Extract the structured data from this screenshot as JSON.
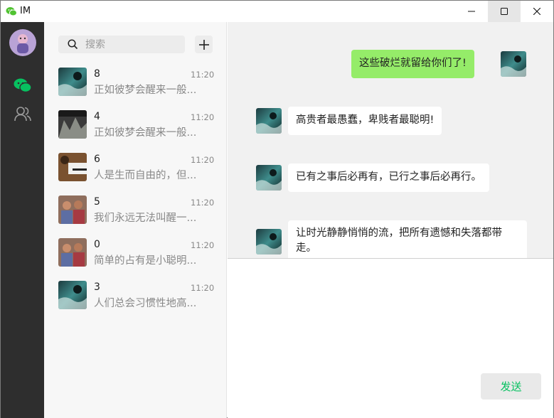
{
  "window": {
    "title": "IM"
  },
  "icons": {
    "app": "wechat-icon",
    "minimize": "minimize-icon",
    "maximize": "maximize-icon",
    "close": "close-icon",
    "chat_nav": "chat-bubbles-icon",
    "contacts_nav": "contacts-icon",
    "search": "search-icon",
    "add": "plus-icon"
  },
  "colors": {
    "nav_bg": "#2e2e2e",
    "accent_green": "#07c160",
    "my_bubble": "#95ec69",
    "their_bubble": "#ffffff",
    "list_bg": "#f7f7f7",
    "chat_bg": "#f1f1f1"
  },
  "search": {
    "placeholder": "搜索"
  },
  "conversations": [
    {
      "name": "8",
      "time": "11:20",
      "preview": "正如彼梦会醒来一般...",
      "avatar": "water"
    },
    {
      "name": "4",
      "time": "11:20",
      "preview": "正如彼梦会醒来一般...",
      "avatar": "landscape"
    },
    {
      "name": "6",
      "time": "11:20",
      "preview": "人是生而自由的，但...",
      "avatar": "desk"
    },
    {
      "name": "5",
      "time": "11:20",
      "preview": "我们永远无法叫醒一...",
      "avatar": "people"
    },
    {
      "name": "0",
      "time": "11:20",
      "preview": "简单的占有是小聪明...",
      "avatar": "people"
    },
    {
      "name": "3",
      "time": "11:20",
      "preview": "人们总会习惯性地高...",
      "avatar": "water"
    }
  ],
  "messages": [
    {
      "from": "me",
      "text": "这些破烂就留给你们了!"
    },
    {
      "from": "them",
      "text": "高贵者最愚蠢，卑贱者最聪明!"
    },
    {
      "from": "them",
      "text": "已有之事后必再有，已行之事后必再行。"
    },
    {
      "from": "them",
      "text": "让时光静静悄悄的流，把所有遗憾和失落都带走。"
    }
  ],
  "compose": {
    "value": "",
    "send_label": "发送"
  }
}
